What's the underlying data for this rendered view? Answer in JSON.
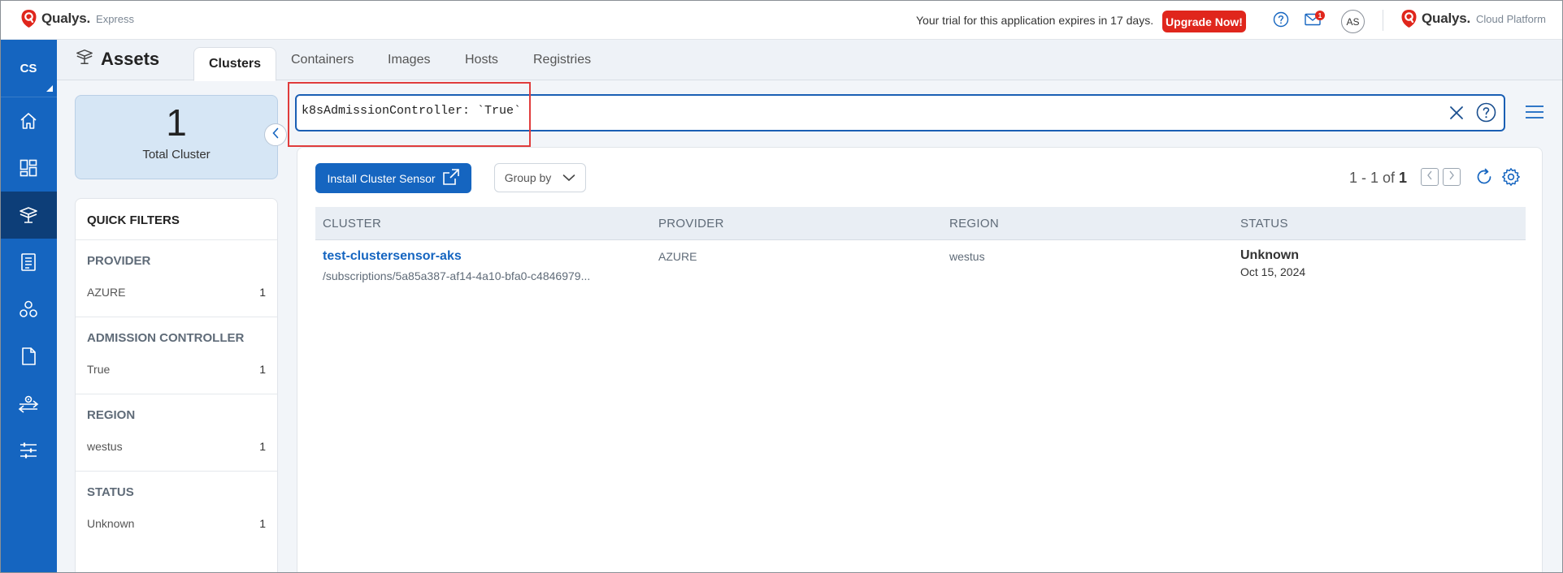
{
  "topbar": {
    "brand_left_name": "Qualys.",
    "brand_left_sub": "Express",
    "trial_text": "Your trial for this application expires in 17 days.",
    "upgrade_label": "Upgrade Now!",
    "mail_badge": "1",
    "user_initials": "AS",
    "brand_right_name": "Qualys.",
    "brand_right_sub": "Cloud Platform"
  },
  "leftnav": {
    "user": "CS",
    "items": [
      "home-icon",
      "dashboard-icon",
      "assets-icon",
      "reports-icon",
      "vulnerabilities-icon",
      "policies-icon",
      "sensors-icon",
      "configuration-icon"
    ],
    "active": "assets-icon"
  },
  "header": {
    "title": "Assets",
    "tabs": [
      {
        "label": "Clusters",
        "active": true
      },
      {
        "label": "Containers",
        "active": false
      },
      {
        "label": "Images",
        "active": false
      },
      {
        "label": "Hosts",
        "active": false
      },
      {
        "label": "Registries",
        "active": false
      }
    ]
  },
  "summary": {
    "count": "1",
    "label": "Total Cluster"
  },
  "quick_filters": {
    "title": "QUICK FILTERS",
    "groups": [
      {
        "title": "PROVIDER",
        "value": "AZURE",
        "count": "1"
      },
      {
        "title": "ADMISSION CONTROLLER",
        "value": "True",
        "count": "1"
      },
      {
        "title": "REGION",
        "value": "westus",
        "count": "1"
      },
      {
        "title": "STATUS",
        "value": "Unknown",
        "count": "1"
      }
    ]
  },
  "search": {
    "query": "k8sAdmissionController: `True`"
  },
  "toolbar": {
    "install_label": "Install Cluster Sensor",
    "groupby_label": "Group by",
    "pager_range": "1 - 1 of ",
    "pager_total": "1"
  },
  "table": {
    "columns": [
      "CLUSTER",
      "PROVIDER",
      "REGION",
      "STATUS"
    ],
    "rows": [
      {
        "cluster": "test-clustersensor-aks",
        "path": "/subscriptions/5a85a387-af14-4a10-bfa0-c4846979...",
        "provider": "AZURE",
        "region": "westus",
        "status": "Unknown",
        "date": "Oct 15, 2024"
      }
    ]
  },
  "colors": {
    "nav_blue": "#1565c0",
    "nav_active": "#0d3e78",
    "upgrade_red": "#e0261c",
    "highlight_red": "#e03c3c"
  }
}
